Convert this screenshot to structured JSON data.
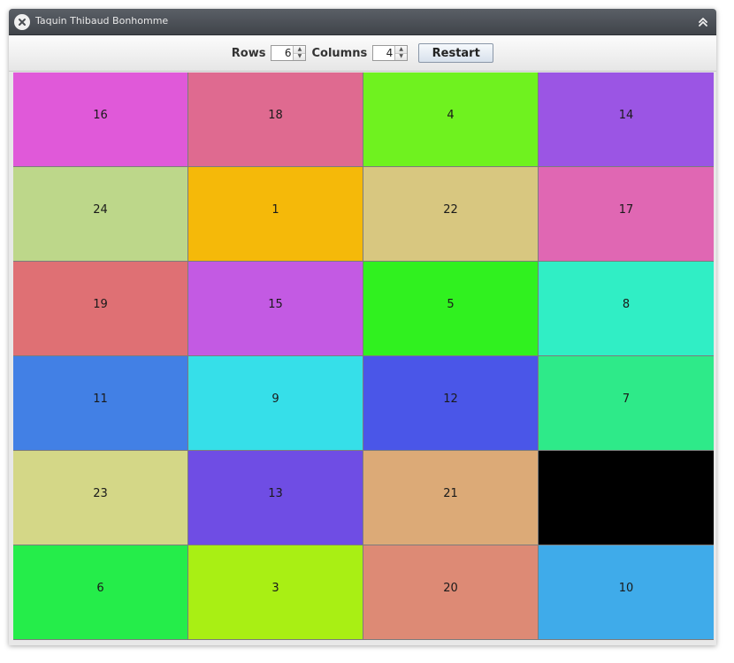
{
  "window": {
    "title": "Taquin Thibaud Bonhomme",
    "close_icon": "close-icon",
    "collapse_icon": "chevron-double-up-icon"
  },
  "toolbar": {
    "rows_label": "Rows",
    "rows_value": "6",
    "columns_label": "Columns",
    "columns_value": "4",
    "restart_label": "Restart"
  },
  "board": {
    "rows": 6,
    "columns": 4,
    "tiles": [
      {
        "label": "16",
        "color": "#e059d9"
      },
      {
        "label": "18",
        "color": "#df6a90"
      },
      {
        "label": "4",
        "color": "#6ff21f"
      },
      {
        "label": "14",
        "color": "#9b55e4"
      },
      {
        "label": "24",
        "color": "#bdd78a"
      },
      {
        "label": "1",
        "color": "#f5b909"
      },
      {
        "label": "22",
        "color": "#d8c780"
      },
      {
        "label": "17",
        "color": "#e067b3"
      },
      {
        "label": "19",
        "color": "#df7074"
      },
      {
        "label": "15",
        "color": "#c35ae3"
      },
      {
        "label": "5",
        "color": "#30f11f"
      },
      {
        "label": "8",
        "color": "#30eec5"
      },
      {
        "label": "11",
        "color": "#4280e5"
      },
      {
        "label": "9",
        "color": "#36dfe9"
      },
      {
        "label": "12",
        "color": "#4a56e8"
      },
      {
        "label": "7",
        "color": "#2eea89"
      },
      {
        "label": "23",
        "color": "#d4d787"
      },
      {
        "label": "13",
        "color": "#6f4de4"
      },
      {
        "label": "21",
        "color": "#dcaa77"
      },
      {
        "label": "",
        "color": "#000000"
      },
      {
        "label": "6",
        "color": "#25ed4a"
      },
      {
        "label": "3",
        "color": "#a9ef14"
      },
      {
        "label": "20",
        "color": "#dd8a75"
      },
      {
        "label": "10",
        "color": "#3fabea"
      }
    ]
  }
}
